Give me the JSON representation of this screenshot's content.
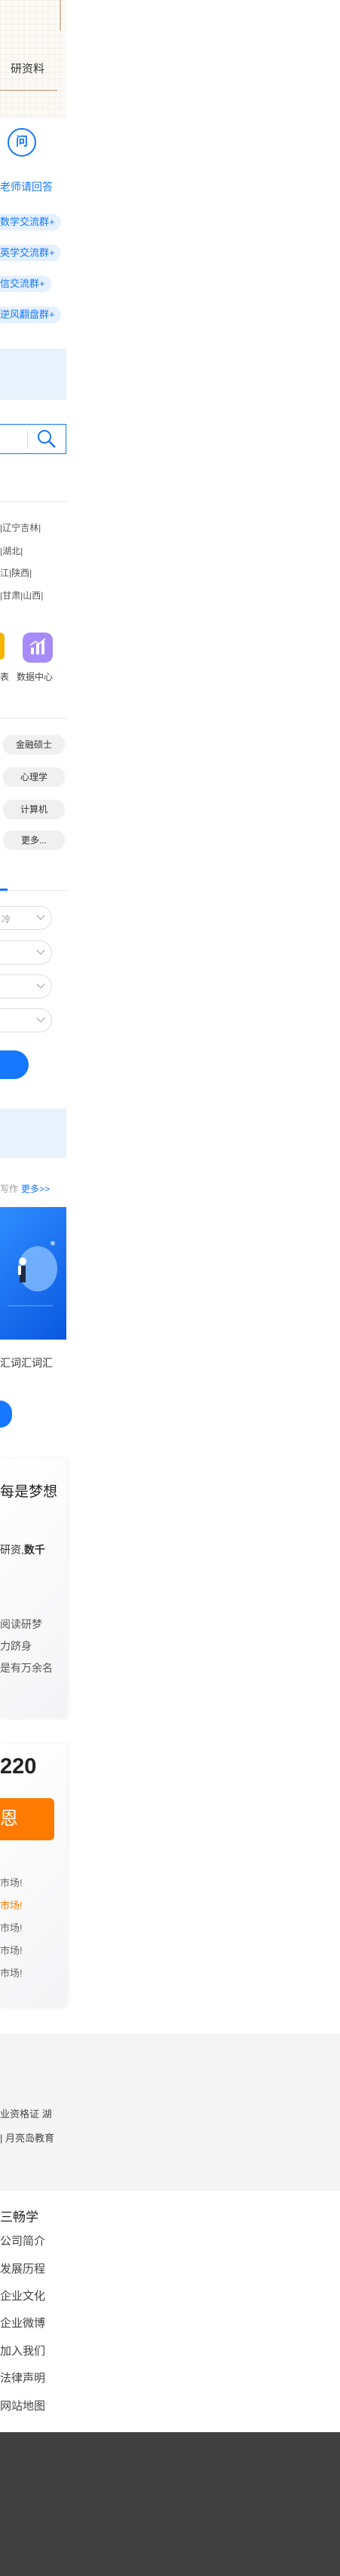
{
  "top_card": {
    "label": "研资料"
  },
  "ask": {
    "label": "老师请回答"
  },
  "groups": [
    "数学交流群+",
    "英学交流群+",
    "信交流群+",
    "逆风翻盘群+"
  ],
  "regions": {
    "row1": "|辽宁吉林|",
    "row2": "|湖北|",
    "row3": "江|陕西|",
    "row4": "|甘肃|山西|"
  },
  "tools": {
    "left_label": "表",
    "right_label": "数据中心"
  },
  "majors": [
    "金融硕士",
    "心理学",
    "计算机",
    "更多..."
  ],
  "selects": [
    "冷",
    "",
    "",
    ""
  ],
  "news": {
    "tab_suffix": "写作",
    "more": "更多>>",
    "caption": "汇词汇词汇"
  },
  "dream": {
    "title": "每是梦想",
    "line1_prefix": "研资,",
    "line1_bold": "数千",
    "para": [
      "阅读研梦",
      "力跻身",
      "是有万余名"
    ]
  },
  "score": {
    "number": "220",
    "button_label": "恩"
  },
  "markets": [
    "市场!",
    "市场!",
    "市场!",
    "市场!",
    "市场!"
  ],
  "footer_cert": {
    "line1": "业资格证  湖",
    "line2": "|  月亮岛教育"
  },
  "about": {
    "title": "三畅学",
    "links": [
      "公司简介",
      "发展历程",
      "企业文化",
      "企业微博",
      "加入我们",
      "法律声明",
      "网站地图"
    ]
  },
  "colors": {
    "accent": "#1677ff",
    "orange": "#ff7a00",
    "dark_footer": "#404040",
    "light_blue": "#e8f2fd"
  }
}
